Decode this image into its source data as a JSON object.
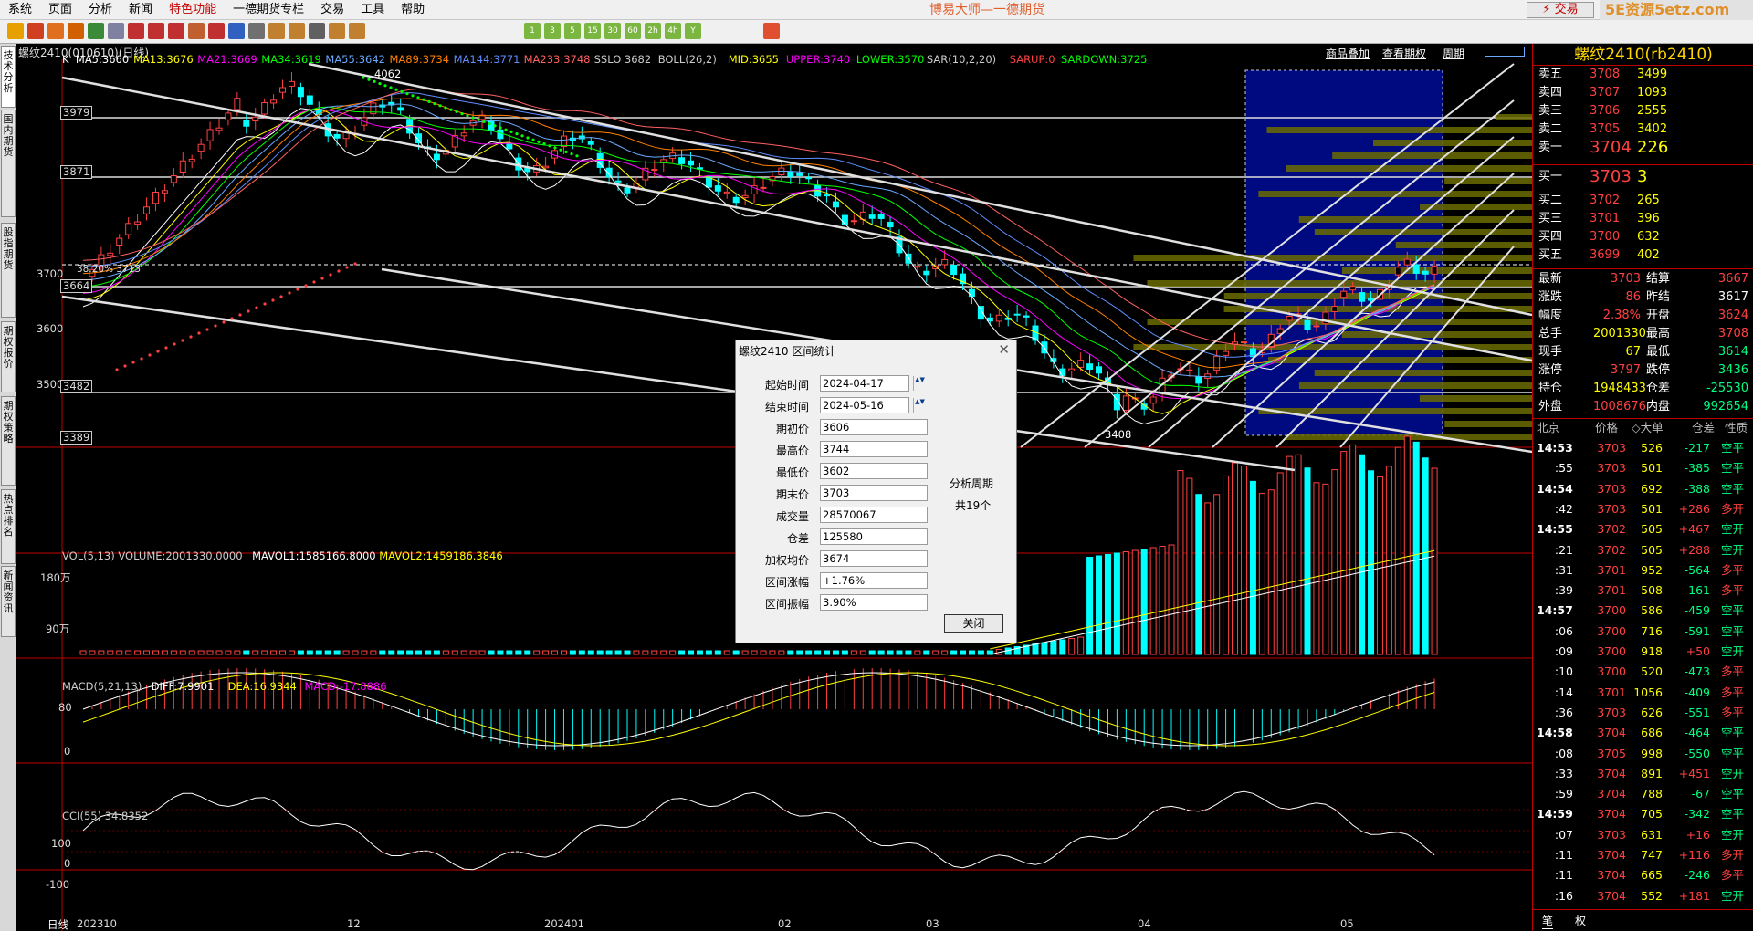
{
  "app": {
    "title": "博易大师—一德期货",
    "trade_label": "⚡ 交易",
    "watermark": "5E资源5etz.com"
  },
  "menu": [
    "系统",
    "页面",
    "分析",
    "新闻",
    "特色功能",
    "一德期货专栏",
    "交易",
    "工具",
    "帮助"
  ],
  "toolbar": {
    "icons": [
      "back-arrow-icon",
      "home-icon",
      "folder-icon",
      "open-icon",
      "refresh-icon",
      "window-icon",
      "zoom-in-icon",
      "zoom-out-icon",
      "pen-icon",
      "paint-icon",
      "funnel-icon",
      "network-icon",
      "grid-icon",
      "exchange-icon",
      "calc-icon",
      "daily-icon",
      "period-icon",
      "step-icon"
    ],
    "periods": [
      "1",
      "3",
      "5",
      "15",
      "30",
      "60",
      "2h",
      "4h",
      "Y"
    ]
  },
  "left_tabs": [
    "技术分析",
    "国内期货",
    "股指期货",
    "期权报价",
    "期权策略",
    "热点排名",
    "新闻资讯"
  ],
  "header": {
    "title": "螺纹2410(010610)(日线)",
    "links": [
      "商品叠加",
      "查看期权",
      "周期"
    ],
    "indicators": [
      {
        "text": "K",
        "color": "#ffffff"
      },
      {
        "text": "MA5:3660",
        "color": "#ffffff"
      },
      {
        "text": "MA13:3676",
        "color": "#ffff00"
      },
      {
        "text": "MA21:3669",
        "color": "#ff00ff"
      },
      {
        "text": "MA34:3619",
        "color": "#00ff00"
      },
      {
        "text": "MA55:3642",
        "color": "#6aa9ff"
      },
      {
        "text": "MA89:3734",
        "color": "#ff8000"
      },
      {
        "text": "MA144:3771",
        "color": "#5f8dff"
      },
      {
        "text": "MA233:3748",
        "color": "#ff6060"
      },
      {
        "text": "SSLO 3682",
        "color": "#cccccc"
      },
      {
        "text": "BOLL(26,2)",
        "color": "#cccccc"
      },
      {
        "text": "MID:3655",
        "color": "#ffff00"
      },
      {
        "text": "UPPER:3740",
        "color": "#ff00ff"
      },
      {
        "text": "LOWER:3570",
        "color": "#00ff00"
      },
      {
        "text": "SAR(10,2,20)",
        "color": "#cccccc"
      },
      {
        "text": "SARUP:0",
        "color": "#ff4040"
      },
      {
        "text": "SARDOWN:3725",
        "color": "#00ff00"
      }
    ]
  },
  "price_axis": {
    "labels": [
      "3700",
      "3600",
      "3500"
    ],
    "boxes": [
      "3979",
      "3871",
      "3664",
      "3482",
      "3389"
    ],
    "high_mark": "4062",
    "low_mark": "3408",
    "fib": "38.20% 3713"
  },
  "volume": {
    "header": [
      {
        "text": "VOL(5,13) VOLUME:2001330.0000",
        "color": "#cccccc"
      },
      {
        "text": "MAVOL1:1585166.8000",
        "color": "#ffffff"
      },
      {
        "text": "MAVOL2:1459186.3846",
        "color": "#ffff00"
      }
    ],
    "labels": [
      "180万",
      "90万"
    ]
  },
  "macd": {
    "header": [
      {
        "text": "MACD(5,21,13)",
        "color": "#cccccc"
      },
      {
        "text": "DIFF:7.9901",
        "color": "#ffffff"
      },
      {
        "text": "DEA:16.9344",
        "color": "#ffff00"
      },
      {
        "text": "MACD:-17.8886",
        "color": "#ff00ff"
      }
    ],
    "labels": [
      "80",
      "0"
    ]
  },
  "cci": {
    "header": "CCI(55) 34.8352",
    "labels": [
      "100",
      "0",
      "-100"
    ]
  },
  "time_axis": {
    "period": "日线",
    "labels": [
      "202310",
      "12",
      "202401",
      "02",
      "03",
      "04",
      "05"
    ]
  },
  "right_panel": {
    "title": "螺纹2410(rb2410)",
    "asks": [
      {
        "label": "卖五",
        "price": "3708",
        "vol": "3499"
      },
      {
        "label": "卖四",
        "price": "3707",
        "vol": "1093"
      },
      {
        "label": "卖三",
        "price": "3706",
        "vol": "2555"
      },
      {
        "label": "卖二",
        "price": "3705",
        "vol": "3402"
      },
      {
        "label": "卖一",
        "price": "3704",
        "vol": "226"
      }
    ],
    "bids": [
      {
        "label": "买一",
        "price": "3703",
        "vol": "3"
      },
      {
        "label": "买二",
        "price": "3702",
        "vol": "265"
      },
      {
        "label": "买三",
        "price": "3701",
        "vol": "396"
      },
      {
        "label": "买四",
        "price": "3700",
        "vol": "632"
      },
      {
        "label": "买五",
        "price": "3699",
        "vol": "402"
      }
    ],
    "stats": [
      [
        "最新",
        "3703",
        "结算",
        "3667"
      ],
      [
        "涨跌",
        "86",
        "昨结",
        "3617"
      ],
      [
        "幅度",
        "2.38%",
        "开盘",
        "3624"
      ],
      [
        "总手",
        "2001330",
        "最高",
        "3708"
      ],
      [
        "现手",
        "67",
        "最低",
        "3614"
      ],
      [
        "涨停",
        "3797",
        "跌停",
        "3436"
      ],
      [
        "持仓",
        "1948433",
        "仓差",
        "-25530"
      ],
      [
        "外盘",
        "1008676",
        "内盘",
        "992654"
      ]
    ],
    "tick_header": [
      "北京",
      "价格",
      "◇大单",
      "仓差",
      "性质"
    ],
    "ticks": [
      [
        "14:53",
        "3703",
        "526",
        "-217",
        "空平"
      ],
      [
        ":55",
        "3703",
        "501",
        "-385",
        "空平"
      ],
      [
        "14:54",
        "3703",
        "692",
        "-388",
        "空平"
      ],
      [
        ":42",
        "3703",
        "501",
        "+286",
        "多开"
      ],
      [
        "14:55",
        "3702",
        "505",
        "+467",
        "空开"
      ],
      [
        ":21",
        "3702",
        "505",
        "+288",
        "空开"
      ],
      [
        ":31",
        "3701",
        "952",
        "-564",
        "多平"
      ],
      [
        ":39",
        "3701",
        "508",
        "-161",
        "多平"
      ],
      [
        "14:57",
        "3700",
        "586",
        "-459",
        "空平"
      ],
      [
        ":06",
        "3700",
        "716",
        "-591",
        "空平"
      ],
      [
        ":09",
        "3700",
        "918",
        "+50",
        "空开"
      ],
      [
        ":10",
        "3700",
        "520",
        "-473",
        "多平"
      ],
      [
        ":14",
        "3701",
        "1056",
        "-409",
        "多平"
      ],
      [
        ":36",
        "3703",
        "626",
        "-551",
        "多平"
      ],
      [
        "14:58",
        "3704",
        "686",
        "-464",
        "空平"
      ],
      [
        ":08",
        "3705",
        "998",
        "-550",
        "空平"
      ],
      [
        ":33",
        "3704",
        "891",
        "+451",
        "空开"
      ],
      [
        ":59",
        "3704",
        "788",
        "-67",
        "空平"
      ],
      [
        "14:59",
        "3704",
        "705",
        "-342",
        "空平"
      ],
      [
        ":07",
        "3703",
        "631",
        "+16",
        "空开"
      ],
      [
        ":11",
        "3704",
        "747",
        "+116",
        "多开"
      ],
      [
        ":11",
        "3704",
        "665",
        "-246",
        "多平"
      ],
      [
        ":16",
        "3704",
        "552",
        "+181",
        "空开"
      ]
    ],
    "bottom_tabs": [
      "笔",
      "权"
    ]
  },
  "dialog": {
    "title": "螺纹2410 区间统计",
    "fields": [
      {
        "label": "起始时间",
        "value": "2024-04-17",
        "spin": true
      },
      {
        "label": "结束时间",
        "value": "2024-05-16",
        "spin": true
      },
      {
        "label": "期初价",
        "value": "3606"
      },
      {
        "label": "最高价",
        "value": "3744"
      },
      {
        "label": "最低价",
        "value": "3602"
      },
      {
        "label": "期末价",
        "value": "3703"
      },
      {
        "label": "成交量",
        "value": "28570067"
      },
      {
        "label": "仓差",
        "value": "125580"
      },
      {
        "label": "加权均价",
        "value": "3674"
      },
      {
        "label": "区间涨幅",
        "value": "+1.76%"
      },
      {
        "label": "区间振幅",
        "value": "3.90%"
      }
    ],
    "period_label": "分析周期",
    "period_count": "共19个",
    "close_label": "关闭"
  }
}
